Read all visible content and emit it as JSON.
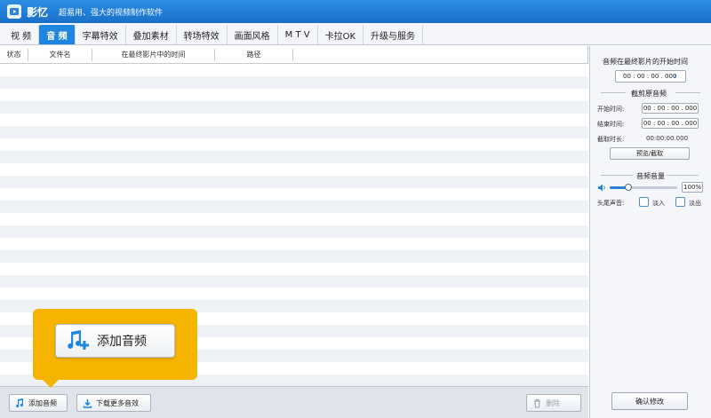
{
  "titlebar": {
    "app_name": "影忆",
    "tagline": "超易用、强大的视频制作软件"
  },
  "tabs": [
    {
      "label": "视  频",
      "active": false
    },
    {
      "label": "音  频",
      "active": true
    },
    {
      "label": "字幕特效",
      "active": false
    },
    {
      "label": "叠加素材",
      "active": false
    },
    {
      "label": "转场特效",
      "active": false
    },
    {
      "label": "画面风格",
      "active": false
    },
    {
      "label": "M T V",
      "active": false
    },
    {
      "label": "卡拉OK",
      "active": false
    },
    {
      "label": "升级与服务",
      "active": false
    }
  ],
  "table": {
    "columns": [
      "状态",
      "文件名",
      "在最终影片中的时间",
      "路径"
    ]
  },
  "bottom": {
    "add_audio": "添加音频",
    "download_more": "下载更多音效",
    "delete": "删除"
  },
  "callout": {
    "label": "添加音频"
  },
  "panel": {
    "start_time_title": "音频在最终影片的开始时间",
    "start_time_value": "00 : 00 : 00 . 000",
    "cut_title": "截剪原音频",
    "begin_label": "开始时间:",
    "begin_value": "00 : 00 : 00 . 000",
    "end_label": "结束时间:",
    "end_value": "00 : 00 : 00 . 000",
    "duration_label": "截取时长:",
    "duration_value": "00:00:00.000",
    "preview_button": "预览/截取",
    "volume_title": "音频音量",
    "volume_value": "100%",
    "volume_level": 1.0,
    "fade_label": "头尾声音:",
    "fade_in": "淡入",
    "fade_out": "淡出",
    "confirm_button": "确认修改"
  },
  "colors": {
    "accent": "#1f86e0",
    "callout": "#f5b400"
  }
}
